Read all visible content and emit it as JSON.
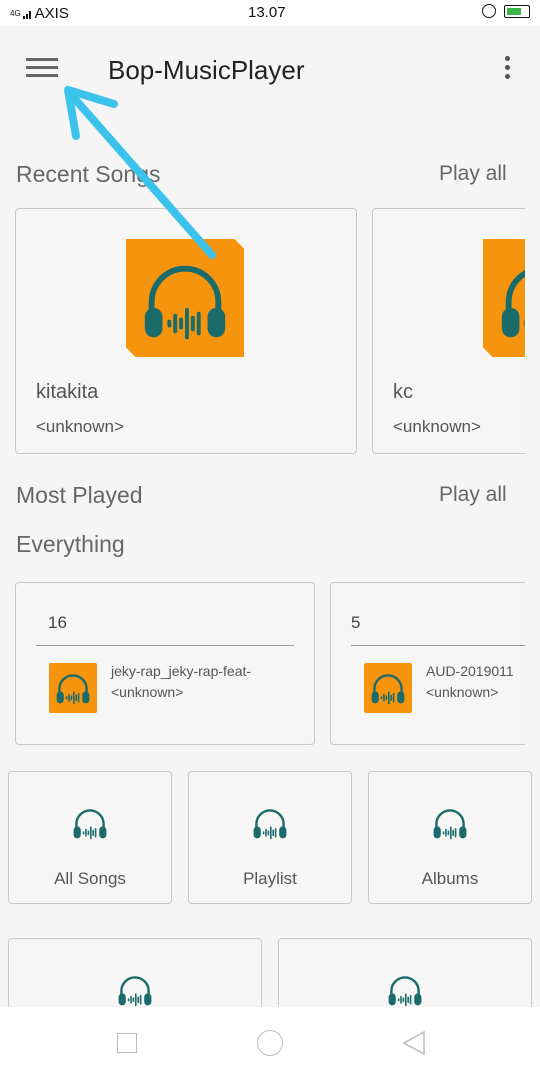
{
  "status_bar": {
    "network": "4G",
    "carrier": "AXIS",
    "time": "13.07"
  },
  "app_bar": {
    "title": "Bop-MusicPlayer"
  },
  "recent_songs": {
    "title": "Recent Songs",
    "play_all": "Play all",
    "items": [
      {
        "name": "kitakita",
        "artist": "<unknown>"
      },
      {
        "name": "kc",
        "artist": "<unknown>"
      }
    ]
  },
  "most_played": {
    "title": "Most Played",
    "play_all": "Play all",
    "subtitle": "Everything",
    "items": [
      {
        "count": "16",
        "name": "jeky-rap_jeky-rap-feat-",
        "artist": "<unknown>"
      },
      {
        "count": "5",
        "name": "AUD-2019011",
        "artist": "<unknown>"
      }
    ]
  },
  "categories": [
    {
      "label": "All Songs"
    },
    {
      "label": "Playlist"
    },
    {
      "label": "Albums"
    },
    {
      "label": ""
    },
    {
      "label": ""
    }
  ],
  "colors": {
    "accent_orange": "#f7940d",
    "icon_teal": "#1c6b6b",
    "annotation_arrow": "#3cc3ec"
  }
}
